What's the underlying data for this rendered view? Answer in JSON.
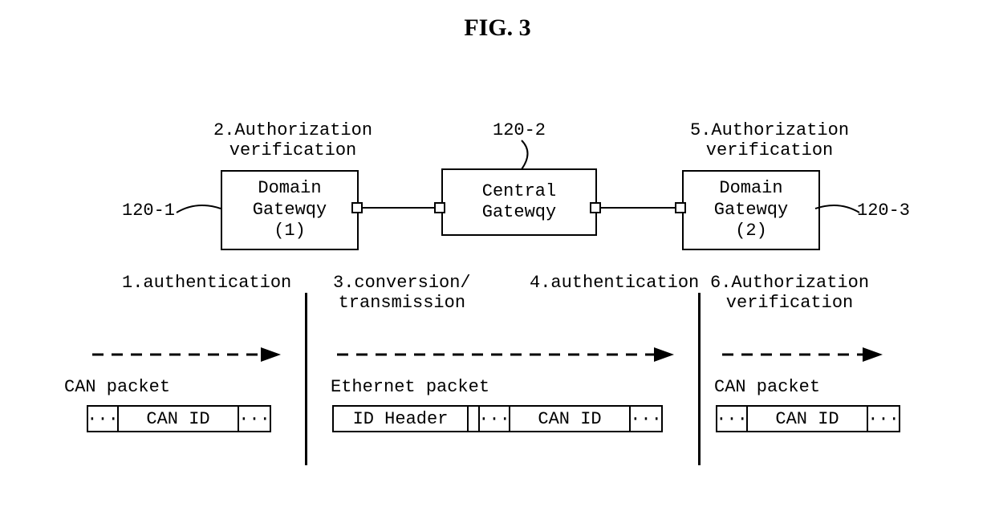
{
  "title": "FIG. 3",
  "refs": {
    "dg1": "120-1",
    "cg": "120-2",
    "dg2": "120-3"
  },
  "boxes": {
    "dg1": "Domain\nGatewqy\n(1)",
    "cg": "Central\nGatewqy",
    "dg2": "Domain\nGatewqy\n(2)"
  },
  "steps": {
    "s1": "1.authentication",
    "s2": "2.Authorization\nverification",
    "s3": "3.conversion/\ntransmission",
    "s4": "4.authentication",
    "s5": "5.Authorization\nverification",
    "s6": "6.Authorization\nverification"
  },
  "packets": {
    "can_label": "CAN packet",
    "eth_label": "Ethernet packet",
    "ellipsis": "···",
    "can_id": "CAN ID",
    "id_header": "ID Header"
  }
}
